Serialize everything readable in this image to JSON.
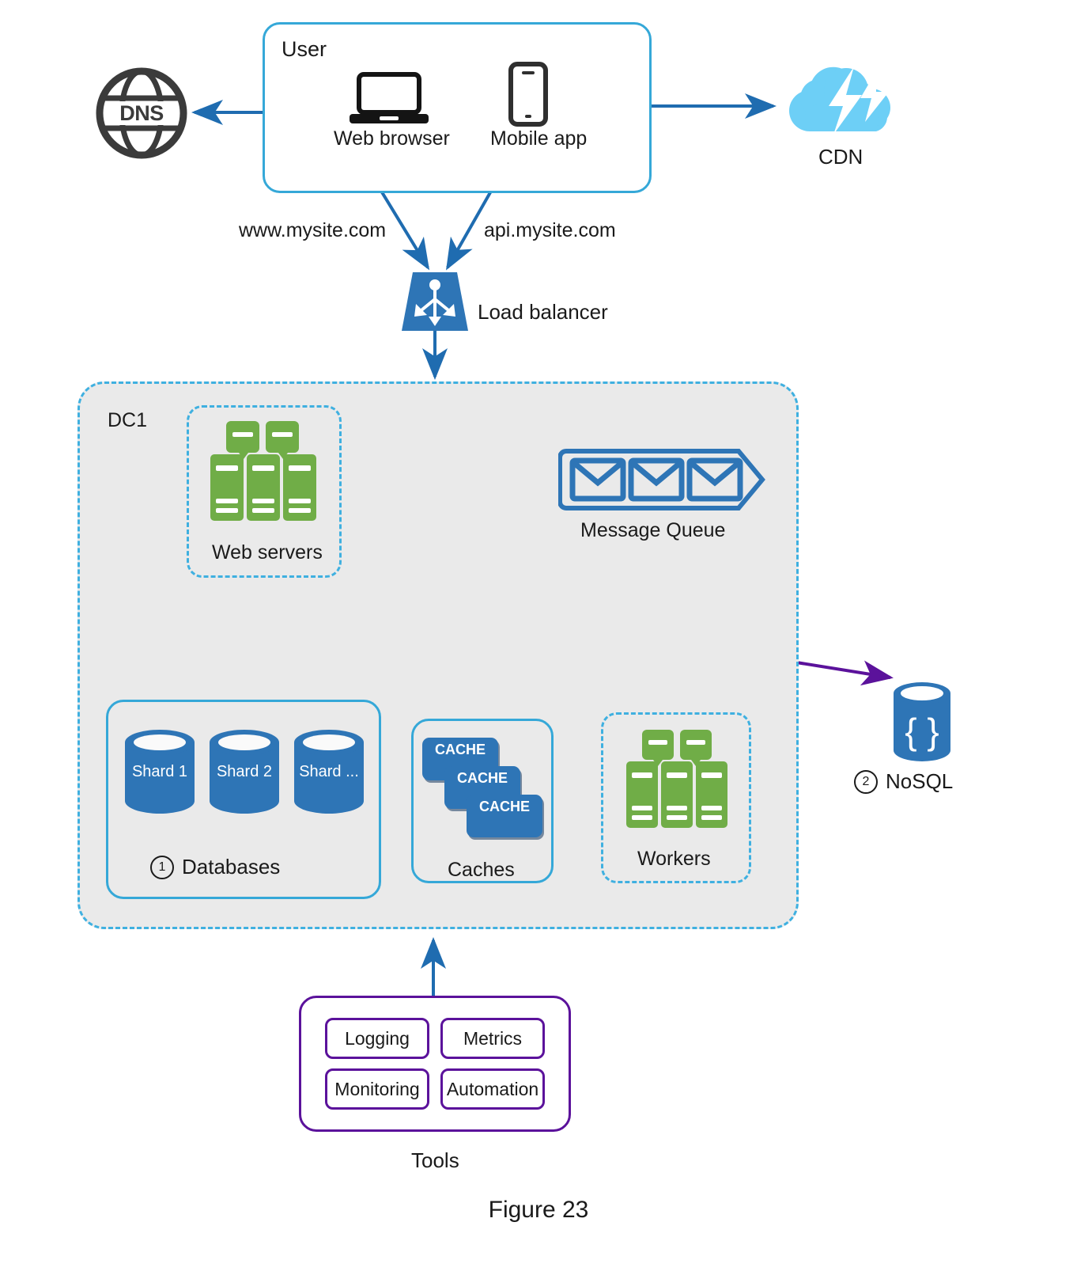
{
  "figure": {
    "caption": "Figure 23"
  },
  "colors": {
    "accent_blue": "#35a8d8",
    "dashed_blue": "#3fb0e0",
    "deep_blue": "#2e75b6",
    "arrow_blue": "#1f6cb0",
    "green_server": "#70ad47",
    "cdn_blue": "#6dcff6",
    "dns_gray": "#3b3b3b",
    "purple": "#5b129b",
    "arrow_green": "#1d6b1d",
    "region_fill": "#eaeaea"
  },
  "dns": {
    "label": "DNS",
    "icon": "globe-icon"
  },
  "user": {
    "title": "User",
    "clients": [
      {
        "label": "Web browser",
        "icon": "laptop-icon"
      },
      {
        "label": "Mobile app",
        "icon": "smartphone-icon"
      }
    ]
  },
  "cdn": {
    "label": "CDN",
    "icon": "cloud-lightning-icon"
  },
  "domains": {
    "web": "www.mysite.com",
    "api": "api.mysite.com"
  },
  "load_balancer": {
    "label": "Load balancer",
    "icon": "load-balancer-icon"
  },
  "datacenter": {
    "title": "DC1",
    "web_servers": {
      "label": "Web servers",
      "icon": "server-rack-icon"
    },
    "message_queue": {
      "label": "Message Queue",
      "icon": "envelope-icon",
      "envelope_count": 3
    },
    "databases": {
      "marker": "1",
      "label": "Databases",
      "shards": [
        "Shard 1",
        "Shard 2",
        "Shard ..."
      ]
    },
    "caches": {
      "label": "Caches",
      "cards": [
        "CACHE",
        "CACHE",
        "CACHE"
      ]
    },
    "workers": {
      "label": "Workers",
      "icon": "server-rack-icon"
    }
  },
  "nosql": {
    "marker": "2",
    "label": "NoSQL",
    "icon": "database-braces-icon"
  },
  "tools": {
    "label": "Tools",
    "items": [
      "Logging",
      "Metrics",
      "Monitoring",
      "Automation"
    ]
  }
}
